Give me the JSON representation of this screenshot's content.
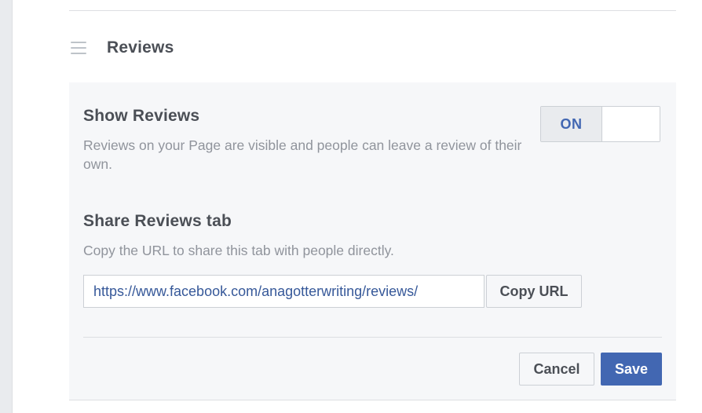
{
  "section": {
    "title": "Reviews",
    "drag_icon": "hamburger-drag-icon"
  },
  "show_reviews": {
    "title": "Show Reviews",
    "description": "Reviews on your Page are visible and people can leave a review of their own.",
    "toggle_label": "ON",
    "toggle_state": "on"
  },
  "share_tab": {
    "title": "Share Reviews tab",
    "description": "Copy the URL to share this tab with people directly.",
    "url_value": "https://www.facebook.com/anagotterwriting/reviews/",
    "copy_label": "Copy URL"
  },
  "actions": {
    "cancel_label": "Cancel",
    "save_label": "Save"
  },
  "colors": {
    "accent": "#4267b2",
    "link": "#365899",
    "panel_bg": "#f6f7f9",
    "muted_text": "#90949c"
  }
}
